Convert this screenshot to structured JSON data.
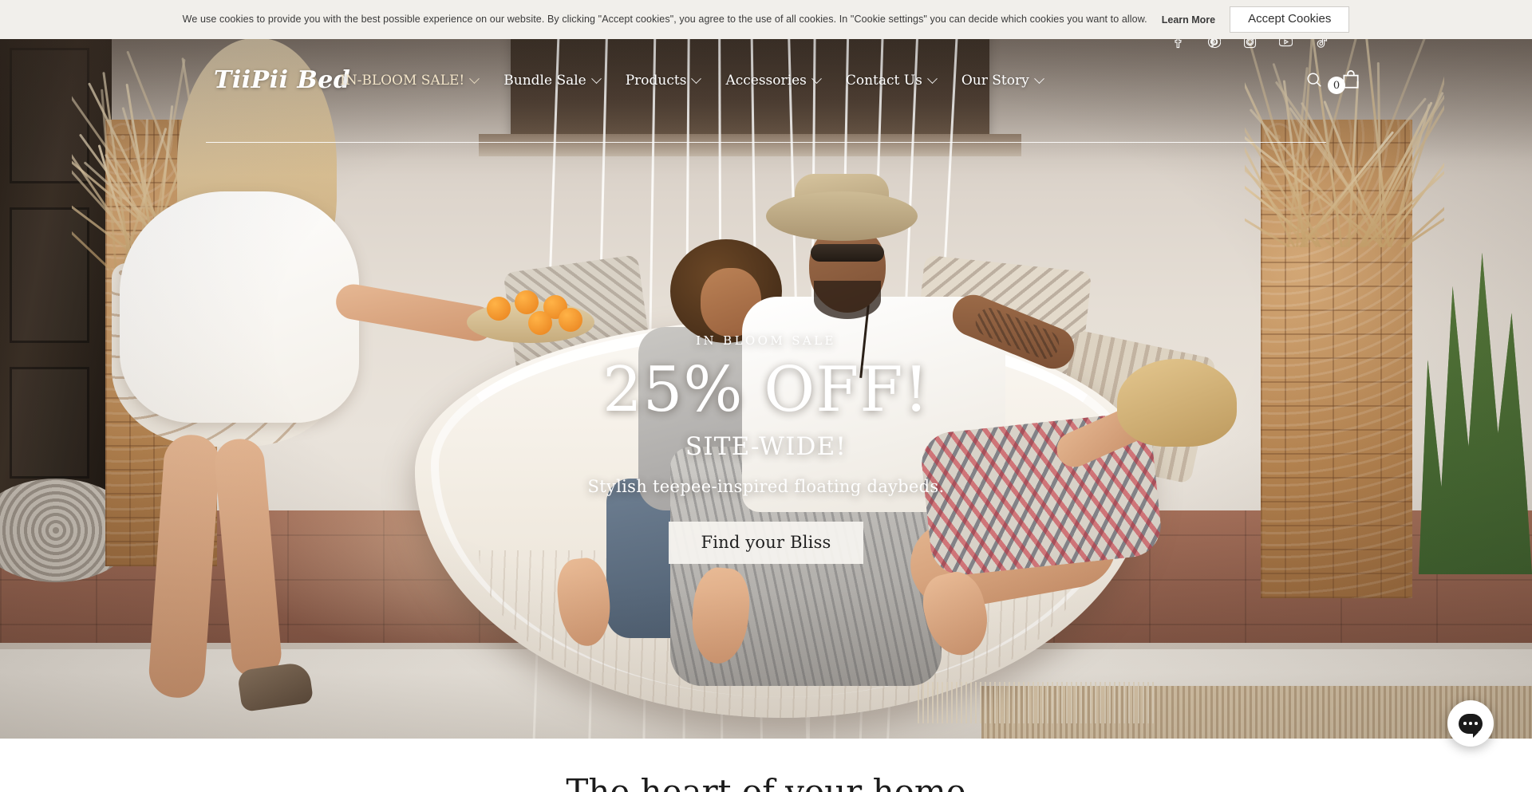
{
  "cookie_banner": {
    "text": "We use cookies to provide you with the best possible experience on our website. By clicking \"Accept cookies\", you agree to the use of all cookies. In \"Cookie settings\" you can decide which cookies you want to allow.",
    "learn_more": "Learn More",
    "accept_label": "Accept Cookies",
    "background": "#f1efeb"
  },
  "header": {
    "logo": "TiiPii Bed",
    "social": [
      {
        "name": "facebook-icon"
      },
      {
        "name": "pinterest-icon"
      },
      {
        "name": "instagram-icon"
      },
      {
        "name": "youtube-icon"
      },
      {
        "name": "tiktok-icon"
      }
    ],
    "nav": [
      {
        "label": "IN-BLOOM SALE!",
        "has_dropdown": true,
        "highlight": true
      },
      {
        "label": "Bundle Sale",
        "has_dropdown": true,
        "highlight": false
      },
      {
        "label": "Products",
        "has_dropdown": true,
        "highlight": false
      },
      {
        "label": "Accessories",
        "has_dropdown": true,
        "highlight": false
      },
      {
        "label": "Contact Us",
        "has_dropdown": true,
        "highlight": false
      },
      {
        "label": "Our Story",
        "has_dropdown": true,
        "highlight": false
      }
    ],
    "cart_count": "0",
    "sale_color": "#f2e4c8"
  },
  "hero": {
    "eyebrow": "IN BLOOM SALE",
    "headline": "25% OFF!",
    "subhead": "SITE-WIDE!",
    "tagline": "Stylish teepee-inspired floating daybeds.",
    "cta_label": "Find your Bliss"
  },
  "chat": {
    "name": "chat-widget",
    "icon": "speech-bubble-icon"
  },
  "next_section": {
    "title": "The heart of your home"
  }
}
